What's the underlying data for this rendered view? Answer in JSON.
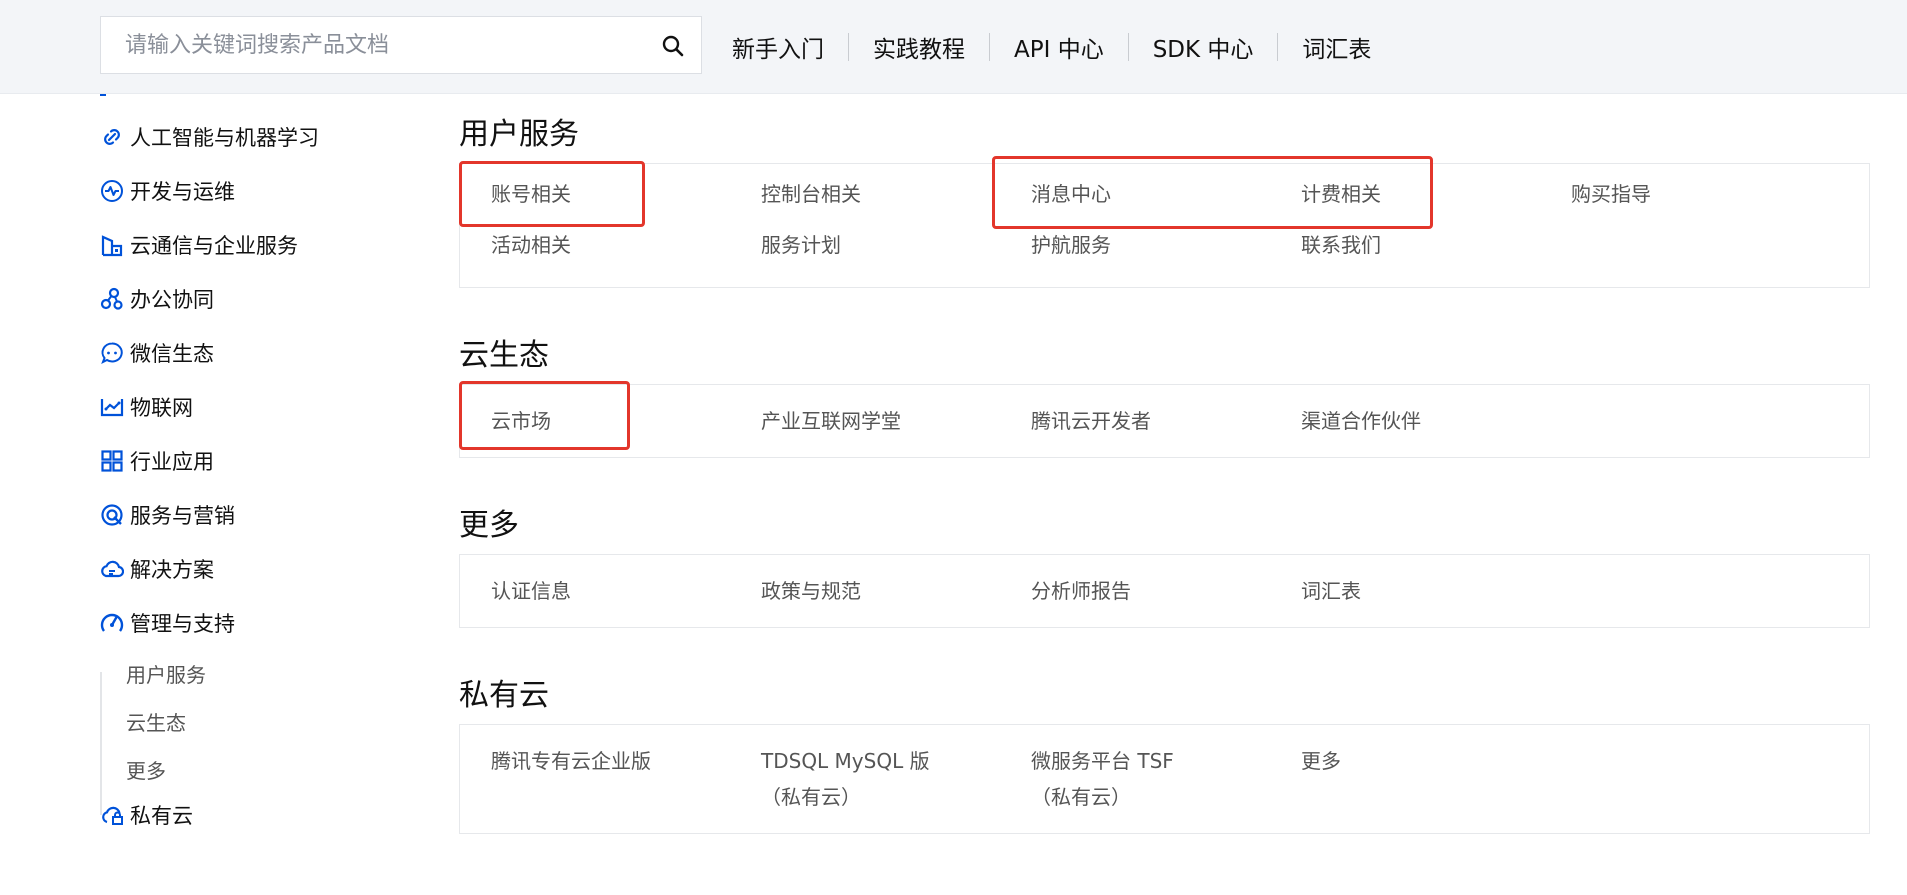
{
  "header": {
    "search_placeholder": "请输入关键词搜索产品文档",
    "nav": [
      "新手入门",
      "实践教程",
      "API 中心",
      "SDK 中心",
      "词汇表"
    ]
  },
  "sidebar": {
    "items": [
      {
        "label": "人工智能与机器学习",
        "icon": "ai-link-icon"
      },
      {
        "label": "开发与运维",
        "icon": "pulse-icon"
      },
      {
        "label": "云通信与企业服务",
        "icon": "building-icon"
      },
      {
        "label": "办公协同",
        "icon": "collaboration-icon"
      },
      {
        "label": "微信生态",
        "icon": "chat-bubble-icon"
      },
      {
        "label": "物联网",
        "icon": "iot-icon"
      },
      {
        "label": "行业应用",
        "icon": "grid-apps-icon"
      },
      {
        "label": "服务与营销",
        "icon": "marketing-icon"
      },
      {
        "label": "解决方案",
        "icon": "cloud-solution-icon"
      },
      {
        "label": "管理与支持",
        "icon": "gauge-icon"
      },
      {
        "label": "私有云",
        "icon": "private-cloud-icon"
      }
    ],
    "sub_items": [
      "用户服务",
      "云生态",
      "更多"
    ]
  },
  "sections": [
    {
      "title": "用户服务",
      "rows": [
        [
          "账号相关",
          "控制台相关",
          "消息中心",
          "计费相关",
          "购买指导"
        ],
        [
          "活动相关",
          "服务计划",
          "护航服务",
          "联系我们"
        ]
      ]
    },
    {
      "title": "云生态",
      "rows": [
        [
          "云市场",
          "产业互联网学堂",
          "腾讯云开发者",
          "渠道合作伙伴"
        ]
      ]
    },
    {
      "title": "更多",
      "rows": [
        [
          "认证信息",
          "政策与规范",
          "分析师报告",
          "词汇表"
        ]
      ]
    },
    {
      "title": "私有云",
      "items": [
        {
          "line1": "腾讯专有云企业版",
          "line2": ""
        },
        {
          "line1": "TDSQL MySQL 版",
          "line2": "（私有云）"
        },
        {
          "line1": "微服务平台 TSF",
          "line2": "（私有云）"
        },
        {
          "line1": "更多",
          "line2": ""
        }
      ]
    }
  ],
  "colors": {
    "accent": "#0052d9",
    "highlight": "#e3362b",
    "header_bg": "#f3f5f8"
  }
}
